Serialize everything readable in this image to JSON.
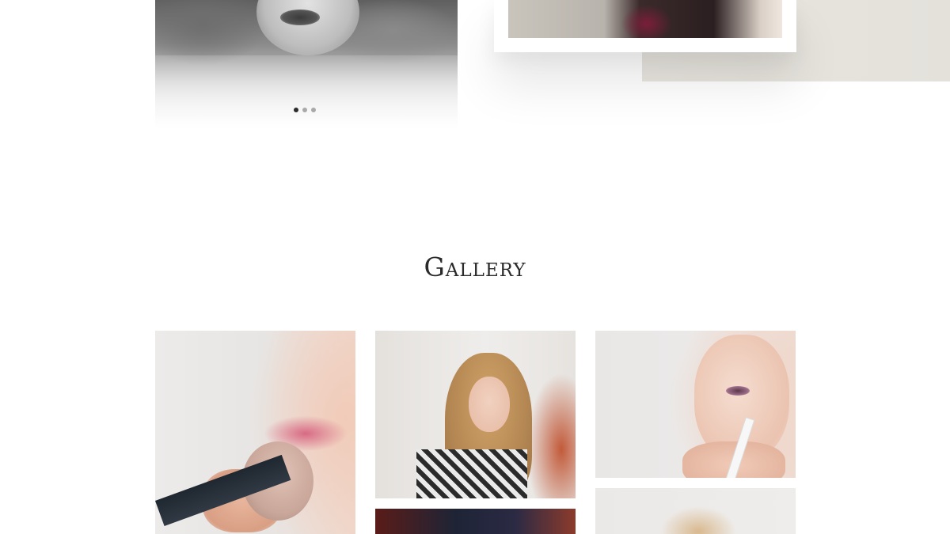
{
  "hero_slider": {
    "slides": [
      {
        "label": "slide-1",
        "active": true
      },
      {
        "label": "slide-2",
        "active": false
      },
      {
        "label": "slide-3",
        "active": false
      }
    ]
  },
  "gallery": {
    "title": "Gallery"
  },
  "colors": {
    "beige_panel": "#e6e3dd",
    "title_text": "#2a2a2a",
    "dot_active": "#2b2b2b",
    "dot_inactive": "#a9a9a9"
  }
}
